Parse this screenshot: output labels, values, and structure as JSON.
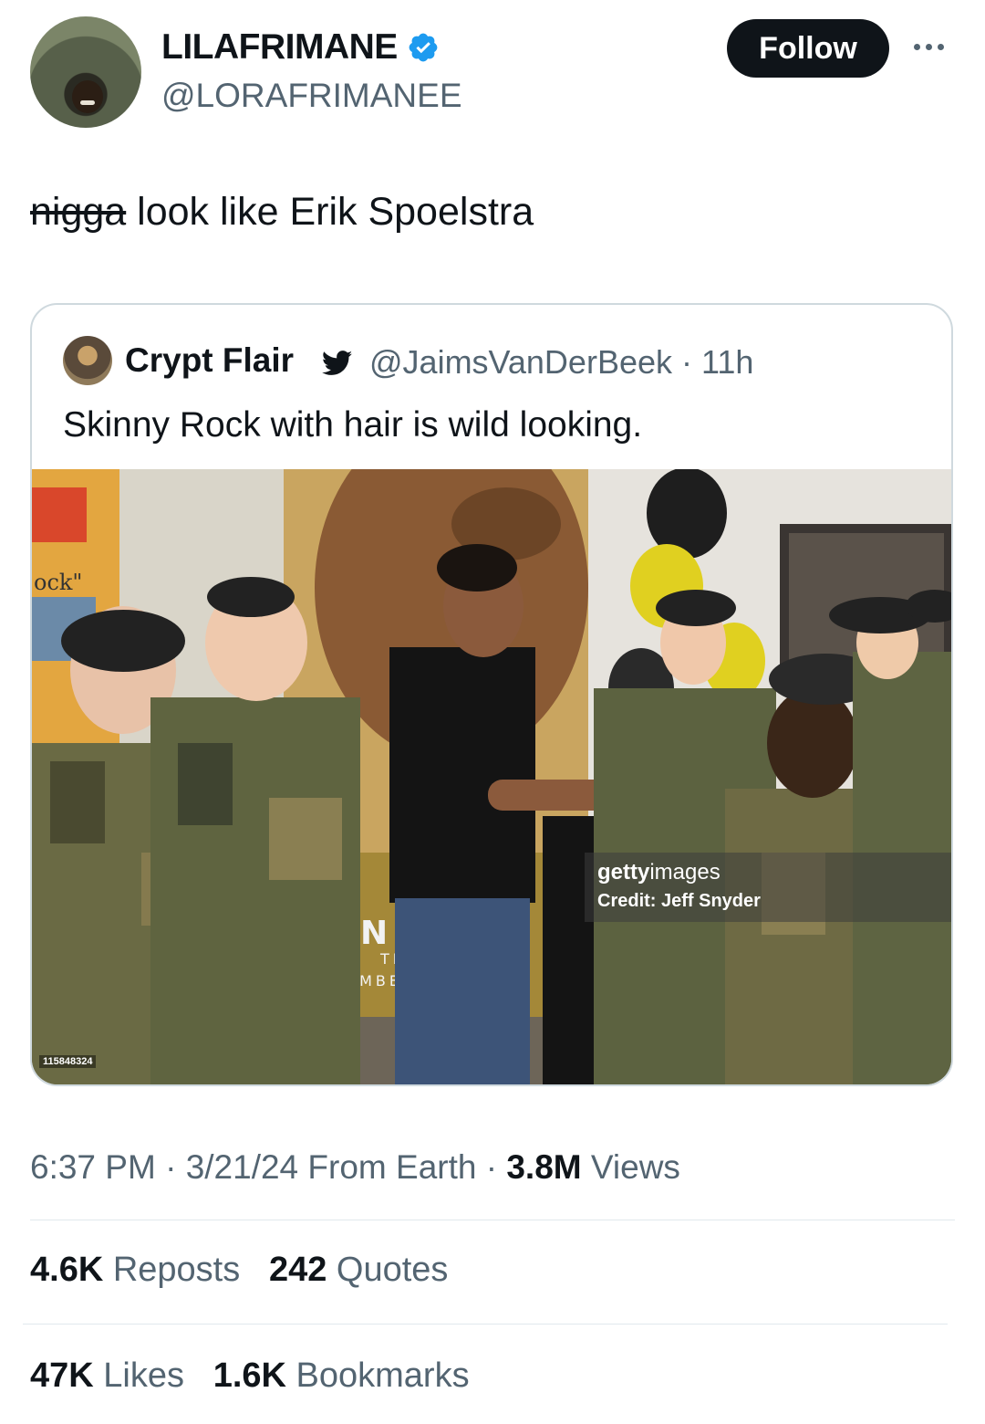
{
  "author": {
    "display_name": "LILAFRIMANE",
    "handle": "@LORAFRIMANEE",
    "verified": true,
    "verified_color": "#1d9bf0"
  },
  "follow_label": "Follow",
  "tweet": {
    "struck_word": "nigga",
    "text": " look like Erik Spoelstra"
  },
  "quoted": {
    "name": "Crypt Flair",
    "handle": "@JaimsVanDerBeek",
    "separator": " · ",
    "age": "11h",
    "text": "Skinny Rock with hair is wild looking.",
    "image": {
      "getty_brand_bold": "getty",
      "getty_brand_light": "images",
      "getty_credit": "Credit: Jeff Snyder",
      "image_id": "115848324",
      "poster_text_1": "ock\"",
      "poster_text_2": "N",
      "poster_text_3": "TR",
      "poster_text_4": "EMBE"
    }
  },
  "meta": {
    "time": "6:37 PM",
    "sep1": " · ",
    "date": "3/21/24",
    "source": " From Earth",
    "sep2": " · ",
    "views_count": "3.8M",
    "views_label": " Views"
  },
  "stats": {
    "reposts_count": "4.6K",
    "reposts_label": " Reposts",
    "quotes_count": "242",
    "quotes_label": " Quotes",
    "likes_count": "47K",
    "likes_label": " Likes",
    "bookmarks_count": "1.6K",
    "bookmarks_label": " Bookmarks"
  },
  "icons": {
    "more": "more-horizontal-icon",
    "verified": "verified-badge-icon",
    "bird": "twitter-bird-icon"
  }
}
